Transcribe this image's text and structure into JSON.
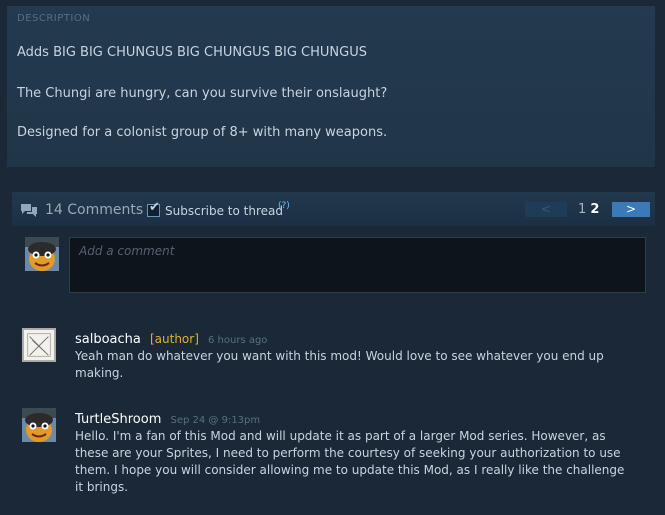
{
  "description": {
    "header": "DESCRIPTION",
    "lines": [
      "Adds BIG BIG CHUNGUS BIG CHUNGUS BIG CHUNGUS",
      "The Chungi are hungry, can you survive their onslaught?",
      "Designed for a colonist group of 8+ with many weapons."
    ]
  },
  "comments_bar": {
    "icon": "chat-bubbles-icon",
    "count_label": "14 Comments",
    "subscribe_label": "Subscribe to thread",
    "subscribe_checked": true,
    "help_label": "(?)",
    "prev_label": "<",
    "pages": [
      "1",
      "2"
    ],
    "current_page": "2",
    "next_label": ">"
  },
  "composer": {
    "placeholder": "Add a comment"
  },
  "comments": [
    {
      "author": "salboacha",
      "tag": "[author]",
      "time": "6 hours ago",
      "text": "Yeah man do whatever you want with this mod! Would love to see whatever you end up making."
    },
    {
      "author": "TurtleShroom",
      "tag": "",
      "time": "Sep 24 @ 9:13pm",
      "text": "Hello. I'm a fan of this Mod and will update it as part of a larger Mod series. However, as these are your Sprites, I need to perform the courtesy of seeking your authorization to use them. I hope you will consider allowing me to update this Mod, as I really like the challenge it brings."
    }
  ],
  "colors": {
    "background": "#1b2838",
    "panel": "#233a4f",
    "author_tag": "#e0b128",
    "link": "#66c0f4",
    "next_button": "#3a7ab8"
  }
}
